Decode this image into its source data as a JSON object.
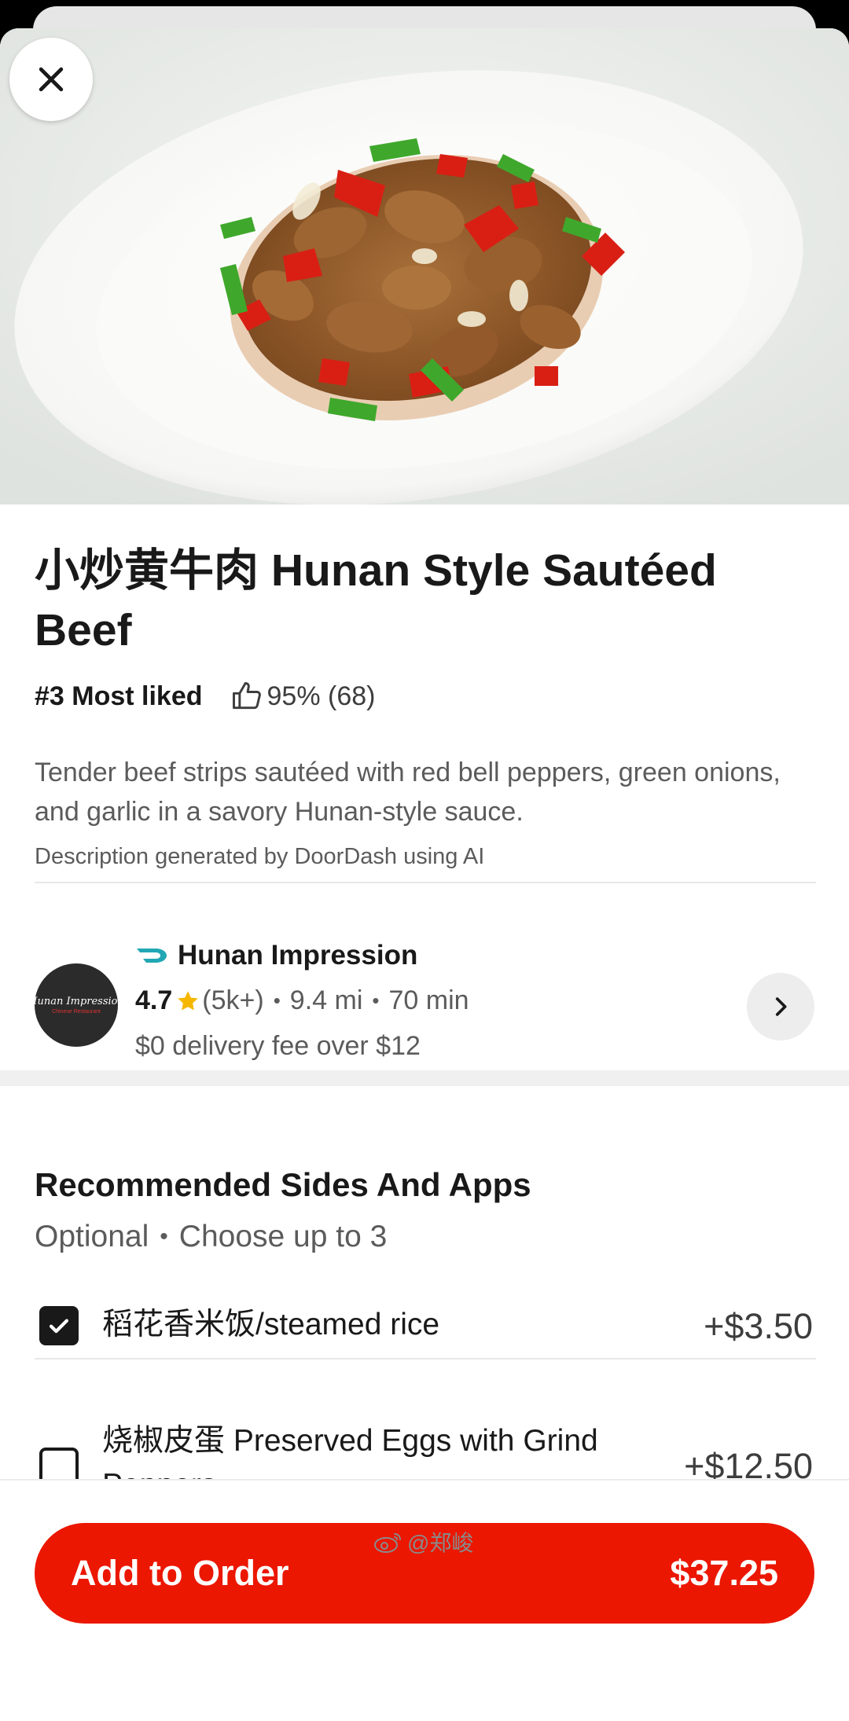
{
  "dish": {
    "title": "小炒黄牛肉 Hunan Style Sautéed Beef",
    "rank": "#3 Most liked",
    "like_stat": "95% (68)",
    "description": "Tender beef strips sautéed with red bell peppers, green onions, and garlic in a savory Hunan-style sauce.",
    "ai_note": "Description generated by DoorDash using AI"
  },
  "icons": {
    "close": "close-icon",
    "thumb": "thumbs-up-icon",
    "brand": "doordash-dash-icon",
    "star": "star-icon",
    "chevron": "chevron-right-icon",
    "check": "checkmark-icon",
    "watermark": "weibo-icon"
  },
  "store": {
    "logo_text": "Hunan Impression",
    "logo_subtext": "Chinese Restaurant",
    "name": "Hunan Impression",
    "rating": "4.7",
    "rating_count": "(5k+)",
    "distance": "9.4 mi",
    "time": "70 min",
    "fee": "$0 delivery fee over $12"
  },
  "sides": {
    "title": "Recommended Sides And Apps",
    "optional": "Optional",
    "limit": "Choose up to 3",
    "options": [
      {
        "label": "稻花香米饭/steamed rice",
        "price": "+$3.50",
        "checked": true
      },
      {
        "label": "烧椒皮蛋 Preserved Eggs with Grind Peppers",
        "price": "+$12.50",
        "checked": false
      }
    ]
  },
  "footer": {
    "button_label": "Add to Order",
    "total": "$37.25"
  },
  "watermark": "@郑峻",
  "colors": {
    "brand_red": "#eb1700",
    "brand_teal": "#22a7b4",
    "star": "#f5b700",
    "text_primary": "#191919",
    "text_secondary": "#5b5b5b"
  }
}
